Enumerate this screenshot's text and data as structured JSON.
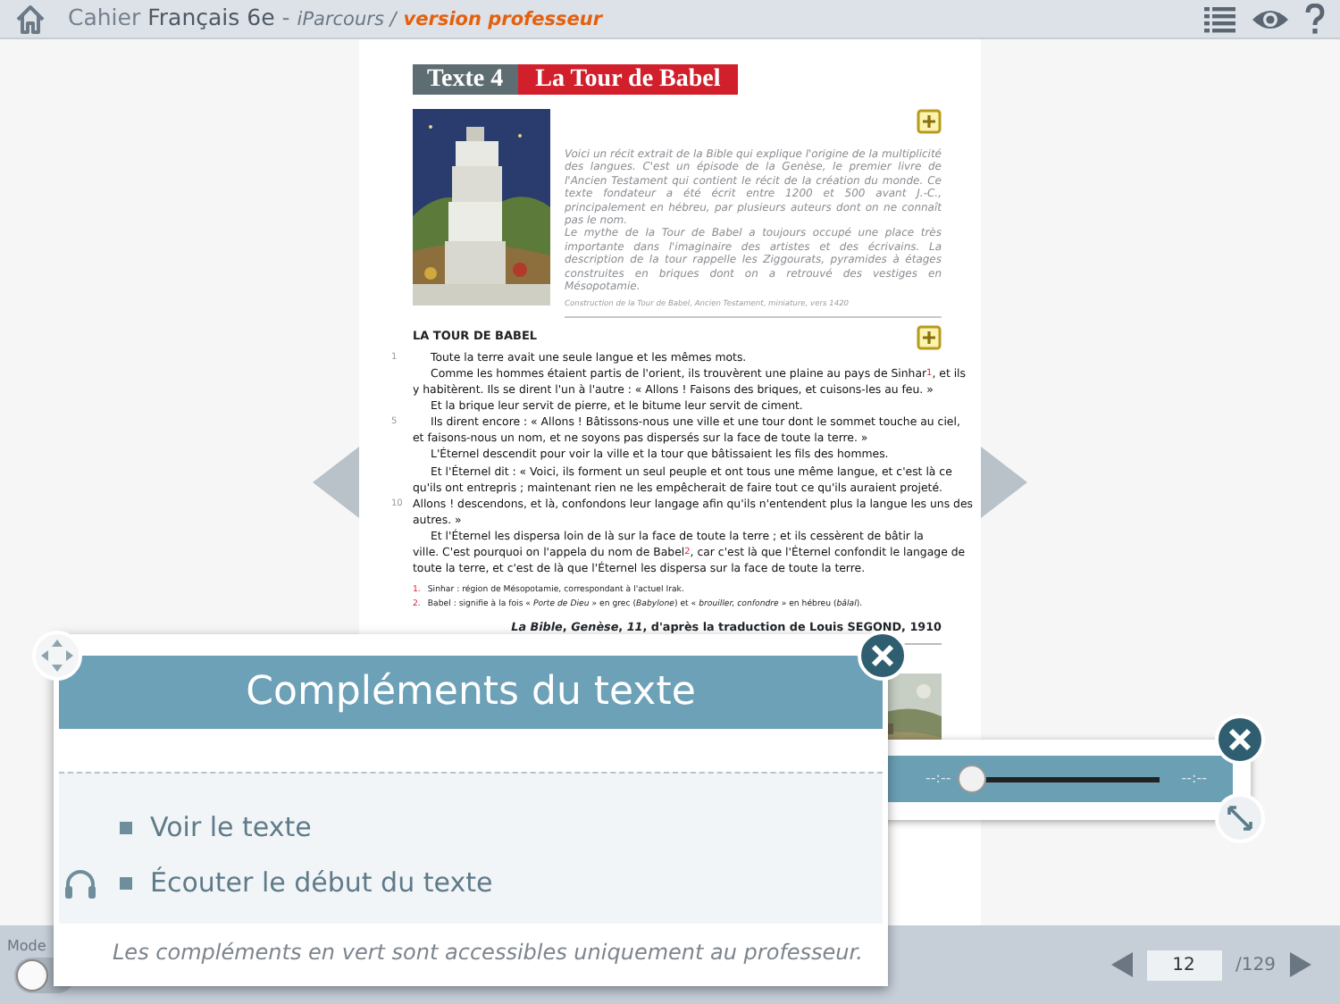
{
  "header": {
    "book_prefix": "Cahier",
    "book_title": "Français 6e",
    "separator": "-",
    "collection": "iParcours /",
    "edition": "version professeur"
  },
  "document": {
    "label": "Texte 4",
    "title": "La Tour de Babel",
    "intro": [
      "Voici un récit extrait de la Bible qui explique l'origine de la multiplicité des langues. C'est un épisode de la Genèse, le premier livre de l'Ancien Testament qui contient le récit de la création du monde. Ce texte fondateur a été écrit entre 1200 et 500 avant J.-C., principalement en hébreu, par plusieurs auteurs dont on ne connaît pas le nom.",
      "Le mythe de la Tour de Babel a toujours occupé une place très importante dans l'imaginaire des artistes et des écrivains. La description de la tour rappelle les Ziggourats, pyramides à étages construites en briques dont on a retrouvé des vestiges en Mésopotamie."
    ],
    "caption": "Construction de la Tour de Babel, Ancien Testament, miniature, vers 1420",
    "section_heading": "LA TOUR DE BABEL",
    "lines": [
      {
        "number": "1",
        "indent": true,
        "text": "Toute la terre avait une seule langue et les mêmes mots."
      },
      {
        "indent": true,
        "text": "Comme les hommes étaient partis de l'orient, ils trouvèrent une plaine au pays de Sinhar$^{1}$, et ils"
      },
      {
        "indent": false,
        "text": "y habitèrent. Ils se dirent l'un à l'autre : « Allons ! Faisons des briques, et cuisons-les au feu. »"
      },
      {
        "indent": true,
        "text": "Et la brique leur servit de pierre, et le bitume leur servit de ciment."
      },
      {
        "number": "5",
        "indent": true,
        "text": "Ils dirent encore : « Allons ! Bâtissons-nous une ville et une tour dont le sommet touche au ciel,"
      },
      {
        "indent": false,
        "text": "et faisons-nous un nom, et ne soyons pas dispersés sur la face de toute la terre. »"
      },
      {
        "indent": true,
        "text": "L'Éternel descendit pour voir la ville et la tour que bâtissaient les fils des hommes."
      },
      {
        "indent": true,
        "text": "Et l'Éternel dit : « Voici, ils forment un seul peuple et ont tous une même langue, et c'est là ce"
      },
      {
        "indent": false,
        "text": "qu'ils ont entrepris ; maintenant rien ne les empêcherait de faire tout ce qu'ils auraient projeté."
      },
      {
        "number": "10",
        "indent": false,
        "text": "Allons ! descendons, et là, confondons leur langage afin qu'ils n'entendent plus la langue les uns des"
      },
      {
        "indent": false,
        "text": "autres. »"
      },
      {
        "indent": true,
        "text": "Et l'Éternel les dispersa loin de là sur la face de toute la terre ; et ils cessèrent de bâtir la"
      },
      {
        "indent": false,
        "text": "ville. C'est pourquoi on l'appela du nom de Babel$^{2}$, car c'est là que l'Éternel confondit le langage de"
      },
      {
        "indent": false,
        "text": "toute la terre, et c'est de là que l'Éternel les dispersa sur la face de toute la terre."
      }
    ],
    "footnotes": [
      {
        "number": "1.",
        "text": "Sinhar : région de Mésopotamie, correspondant à l'actuel Irak."
      },
      {
        "number": "2.",
        "text": "Babel : signifie à la fois « *Porte de Dieu* » en grec (*Babylone*) et « *brouiller, confondre* » en hébreu (*bâlal*)."
      }
    ],
    "source": "*La Bible*, *Genèse*, *11*, d'après la traduction de Louis SEGOND, 1910"
  },
  "popup": {
    "title": "Compléments du texte",
    "items": [
      {
        "label": "Voir le texte",
        "audio": false
      },
      {
        "label": "Écouter le début du texte",
        "audio": true
      }
    ],
    "note": "Les compléments en vert sont accessibles uniquement au professeur."
  },
  "player": {
    "elapsed": "--:--",
    "duration": "--:--",
    "level": 0
  },
  "footer": {
    "mode_label": "Mode",
    "mode_on": false,
    "page": "12",
    "total": "/129"
  }
}
